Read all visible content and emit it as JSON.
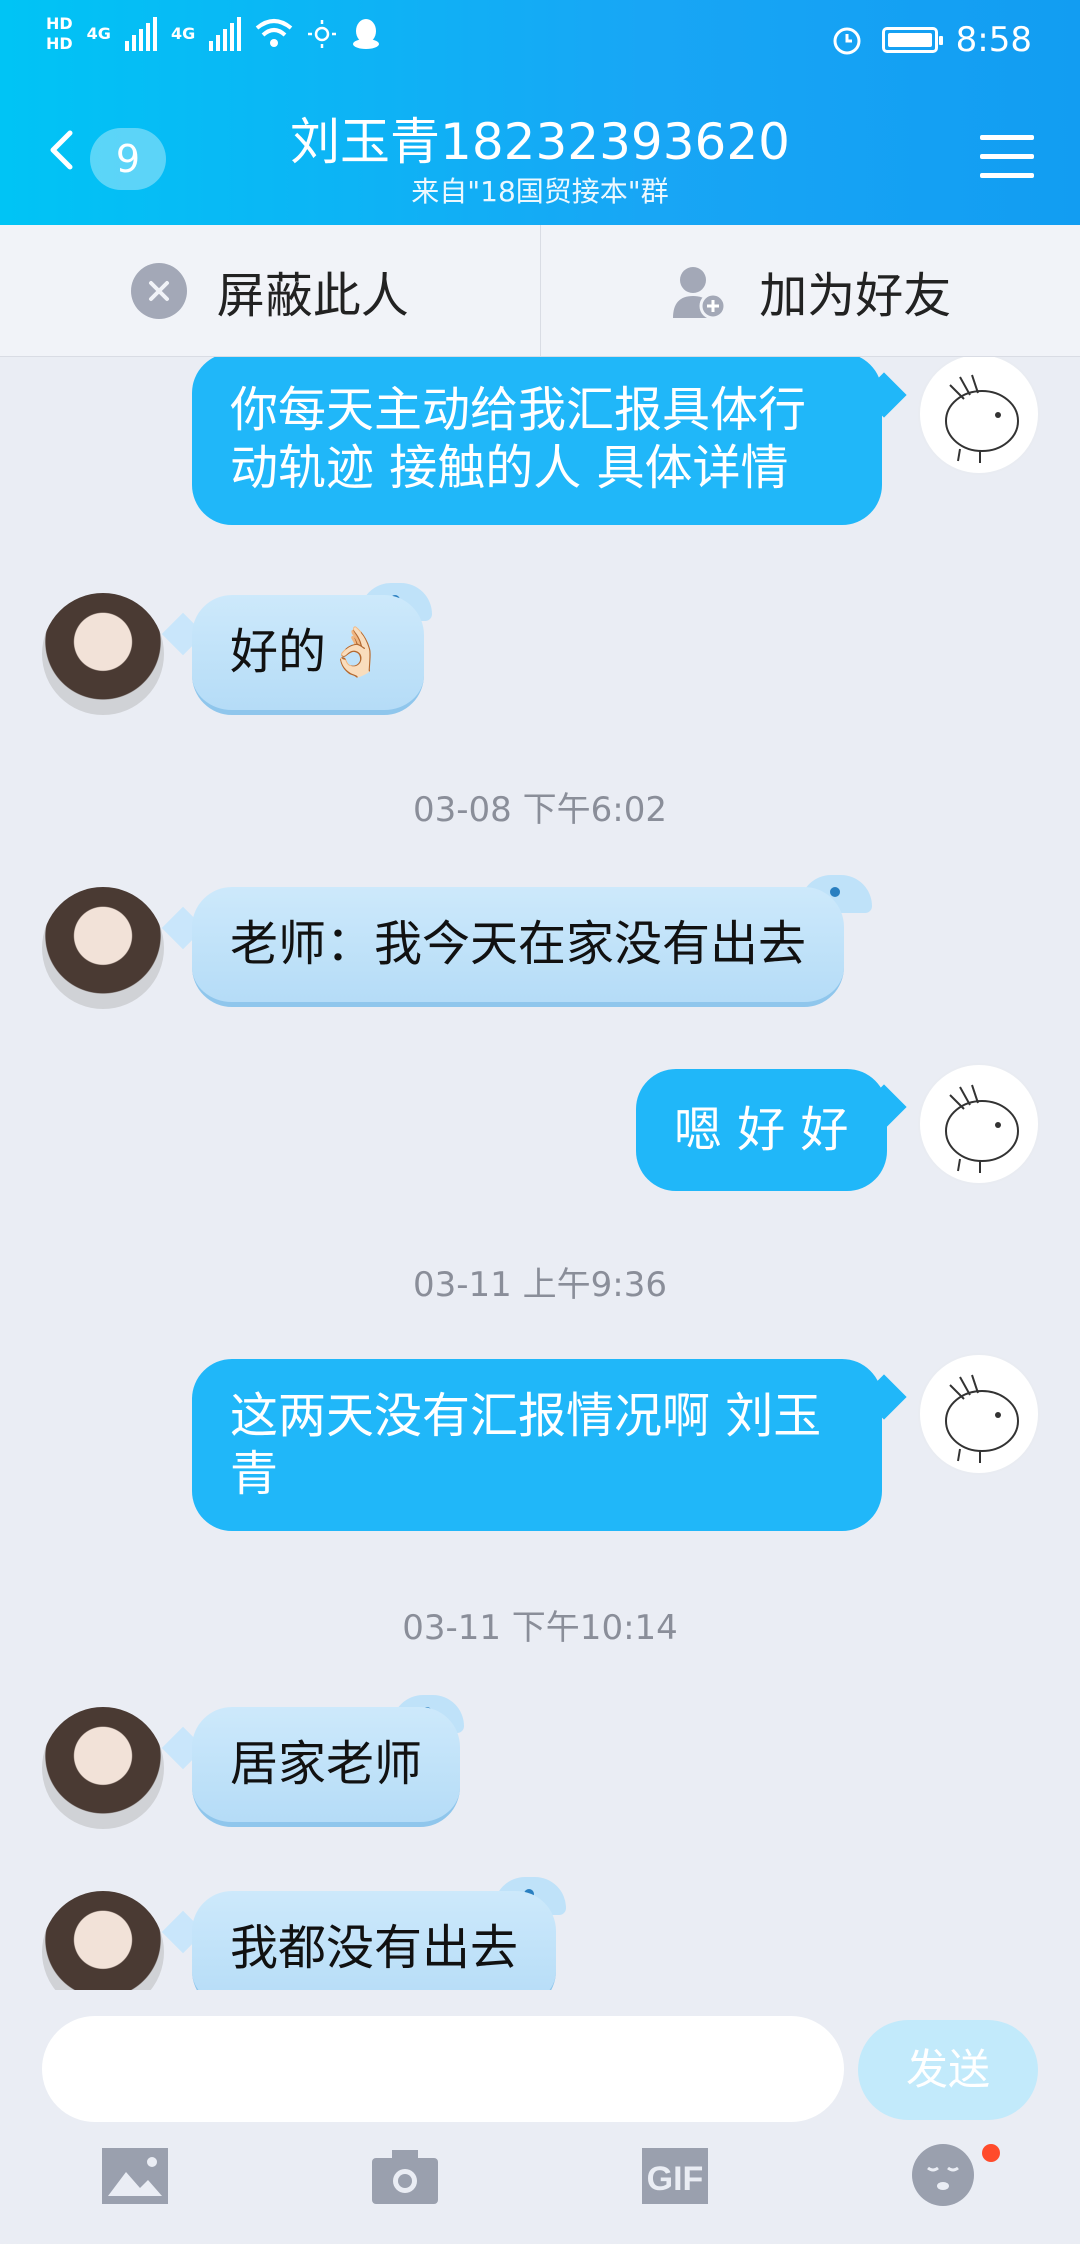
{
  "status_bar": {
    "left_labels": [
      "HD",
      "HD",
      "4G",
      "4G"
    ],
    "time": "8:58"
  },
  "header": {
    "back_count": "9",
    "title": "刘玉青18232393620",
    "subtitle": "来自\"18国贸接本\"群"
  },
  "actions": {
    "block": "屏蔽此人",
    "add_friend": "加为好友"
  },
  "messages": [
    {
      "side": "out",
      "text": "你每天主动给我汇报具体行动轨迹 接触的人 具体详情"
    },
    {
      "side": "in",
      "text": "好的👌🏻"
    },
    {
      "side": "time",
      "text": "03-08 下午6:02"
    },
    {
      "side": "in",
      "text": "老师：我今天在家没有出去"
    },
    {
      "side": "out",
      "text": "嗯 好 好"
    },
    {
      "side": "time",
      "text": "03-11 上午9:36"
    },
    {
      "side": "out",
      "text": "这两天没有汇报情况啊 刘玉青"
    },
    {
      "side": "time",
      "text": "03-11 下午10:14"
    },
    {
      "side": "in",
      "text": "居家老师"
    },
    {
      "side": "in",
      "text": "我都没有出去"
    }
  ],
  "input": {
    "placeholder": "",
    "send_label": "发送"
  },
  "toolbar": [
    "image-icon",
    "camera-icon",
    "gif-icon",
    "emoji-icon"
  ],
  "colors": {
    "header": "#18a6f5",
    "outgoing_bubble": "#20b7f9",
    "incoming_bubble": "#c9e6fb",
    "background": "#eaedf4"
  }
}
